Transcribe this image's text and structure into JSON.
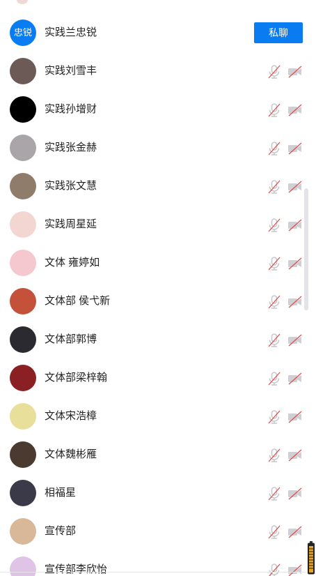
{
  "action": {
    "private_chat_label": "私聊"
  },
  "members": [
    {
      "name": "实践兰忠锐",
      "avatar_text": "忠锐",
      "avatar_color": "#0a7cf2"
    },
    {
      "name": "实践刘雪丰",
      "avatar_color": "#6b5a55"
    },
    {
      "name": "实践孙增财",
      "avatar_color": "#000000"
    },
    {
      "name": "实践张金赫",
      "avatar_color": "#a9a5a8"
    },
    {
      "name": "实践张文慧",
      "avatar_color": "#8f7c6a"
    },
    {
      "name": "实践周星延",
      "avatar_color": "#f3d6d2"
    },
    {
      "name": "文体 雍婷如",
      "avatar_color": "#f5c8cf"
    },
    {
      "name": "文体部 侯弋新",
      "avatar_color": "#c4523a"
    },
    {
      "name": "文体部郭博",
      "avatar_color": "#2a2a30"
    },
    {
      "name": "文体部梁梓翰",
      "avatar_color": "#8a1f24"
    },
    {
      "name": "文体宋浩樟",
      "avatar_color": "#e8e09a"
    },
    {
      "name": "文体魏彬雁",
      "avatar_color": "#4a3a30"
    },
    {
      "name": "相福星",
      "avatar_color": "#3a3a48"
    },
    {
      "name": "宣传部",
      "avatar_color": "#d9b89a"
    },
    {
      "name": "宣传部李欣怡",
      "avatar_color": "#e0c4e8"
    }
  ],
  "icons": {
    "mic": "mic-muted-icon",
    "camera": "camera-off-icon"
  },
  "colors": {
    "accent": "#0a7cf2",
    "muted_icon": "#c9c9cc",
    "slash": "#e05050"
  }
}
